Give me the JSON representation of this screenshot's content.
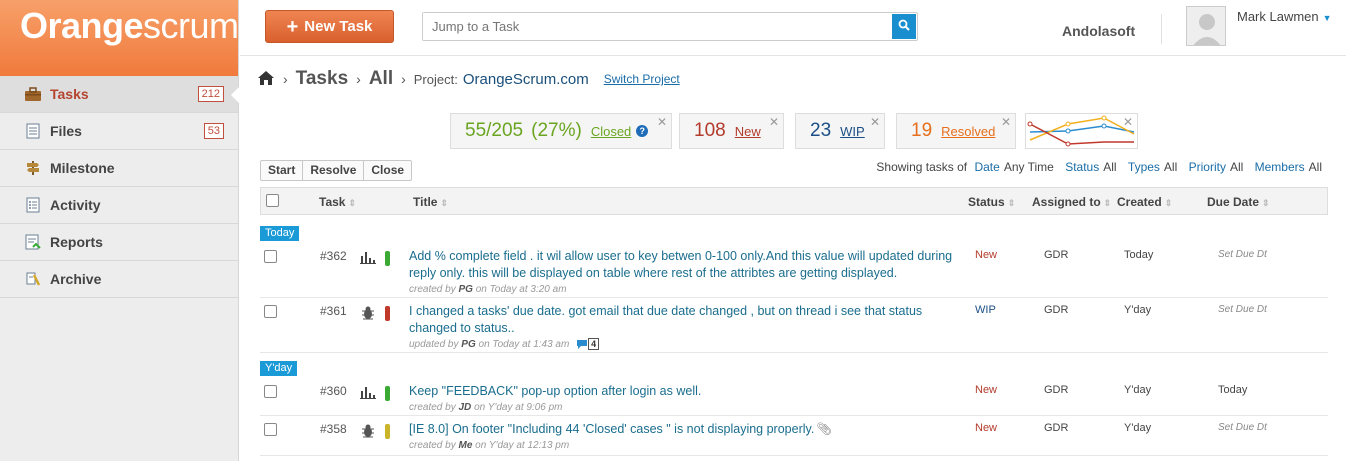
{
  "brand": {
    "logo_bold": "Orange",
    "logo_light": "scrum"
  },
  "sidebar": {
    "items": [
      {
        "label": "Tasks",
        "count": "212",
        "icon": "briefcase-icon"
      },
      {
        "label": "Files",
        "count": "53",
        "icon": "file-icon"
      },
      {
        "label": "Milestone",
        "icon": "signpost-icon"
      },
      {
        "label": "Activity",
        "icon": "activity-icon"
      },
      {
        "label": "Reports",
        "icon": "report-icon"
      },
      {
        "label": "Archive",
        "icon": "archive-icon"
      }
    ]
  },
  "topbar": {
    "new_task_label": "New Task",
    "search_placeholder": "Jump to a Task",
    "company": "Andolasoft",
    "user_name": "Mark Lawmen"
  },
  "breadcrumb": {
    "section": "Tasks",
    "filter": "All",
    "project_label": "Project:",
    "project_name": "OrangeScrum.com",
    "switch_label": "Switch Project"
  },
  "stats": {
    "closed": {
      "value": "55/205",
      "percent": "(27%)",
      "label": "Closed"
    },
    "new": {
      "value": "108",
      "label": "New"
    },
    "wip": {
      "value": "23",
      "label": "WIP"
    },
    "resolved": {
      "value": "19",
      "label": "Resolved"
    }
  },
  "actions": [
    "Start",
    "Resolve",
    "Close"
  ],
  "filters": {
    "prefix": "Showing tasks of",
    "date_label": "Date",
    "date_value": "Any Time",
    "status_label": "Status",
    "status_value": "All",
    "types_label": "Types",
    "types_value": "All",
    "priority_label": "Priority",
    "priority_value": "All",
    "members_label": "Members",
    "members_value": "All"
  },
  "table": {
    "headers": {
      "task": "Task",
      "title": "Title",
      "status": "Status",
      "assigned": "Assigned to",
      "created": "Created",
      "due": "Due Date"
    },
    "groups": [
      "Today",
      "Y'day"
    ],
    "rows": [
      {
        "num": "#362",
        "type": "bar-chart-icon",
        "priority_color": "#3aaa35",
        "title": "Add % complete field . it wil allow user to key betwen 0-100 only.And this value will updated during reply only. this will be displayed on table where rest of the attribtes are getting displayed.",
        "meta_prefix": "created by",
        "meta_user": "PG",
        "meta_suffix": "on Today at 3:20 am",
        "status": "New",
        "assigned": "GDR",
        "created": "Today",
        "due": "Set Due Dt"
      },
      {
        "num": "#361",
        "type": "bug-icon",
        "priority_color": "#c0392b",
        "title": "I changed a tasks' due date. got email that due date changed , but on thread i see that status changed to status..",
        "meta_prefix": "updated by",
        "meta_user": "PG",
        "meta_suffix": "on Today at 1:43 am",
        "comments": "4",
        "status": "WIP",
        "assigned": "GDR",
        "created": "Y'day",
        "due": "Set Due Dt"
      },
      {
        "num": "#360",
        "type": "bar-chart-icon",
        "priority_color": "#3aaa35",
        "title": "Keep \"FEEDBACK\" pop-up option after login as well.",
        "meta_prefix": "created by",
        "meta_user": "JD",
        "meta_suffix": "on Y'day at 9:06 pm",
        "status": "New",
        "assigned": "GDR",
        "created": "Y'day",
        "due": "Today"
      },
      {
        "num": "#358",
        "type": "bug-icon",
        "priority_color": "#c9b42a",
        "title": "[IE 8.0] On footer \"Including 44 'Closed' cases \" is not displaying properly.",
        "meta_prefix": "created by",
        "meta_user": "Me",
        "meta_suffix": "on Y'day at 12:13 pm",
        "status": "New",
        "assigned": "GDR",
        "created": "Y'day",
        "due": "Set Due Dt"
      }
    ]
  }
}
